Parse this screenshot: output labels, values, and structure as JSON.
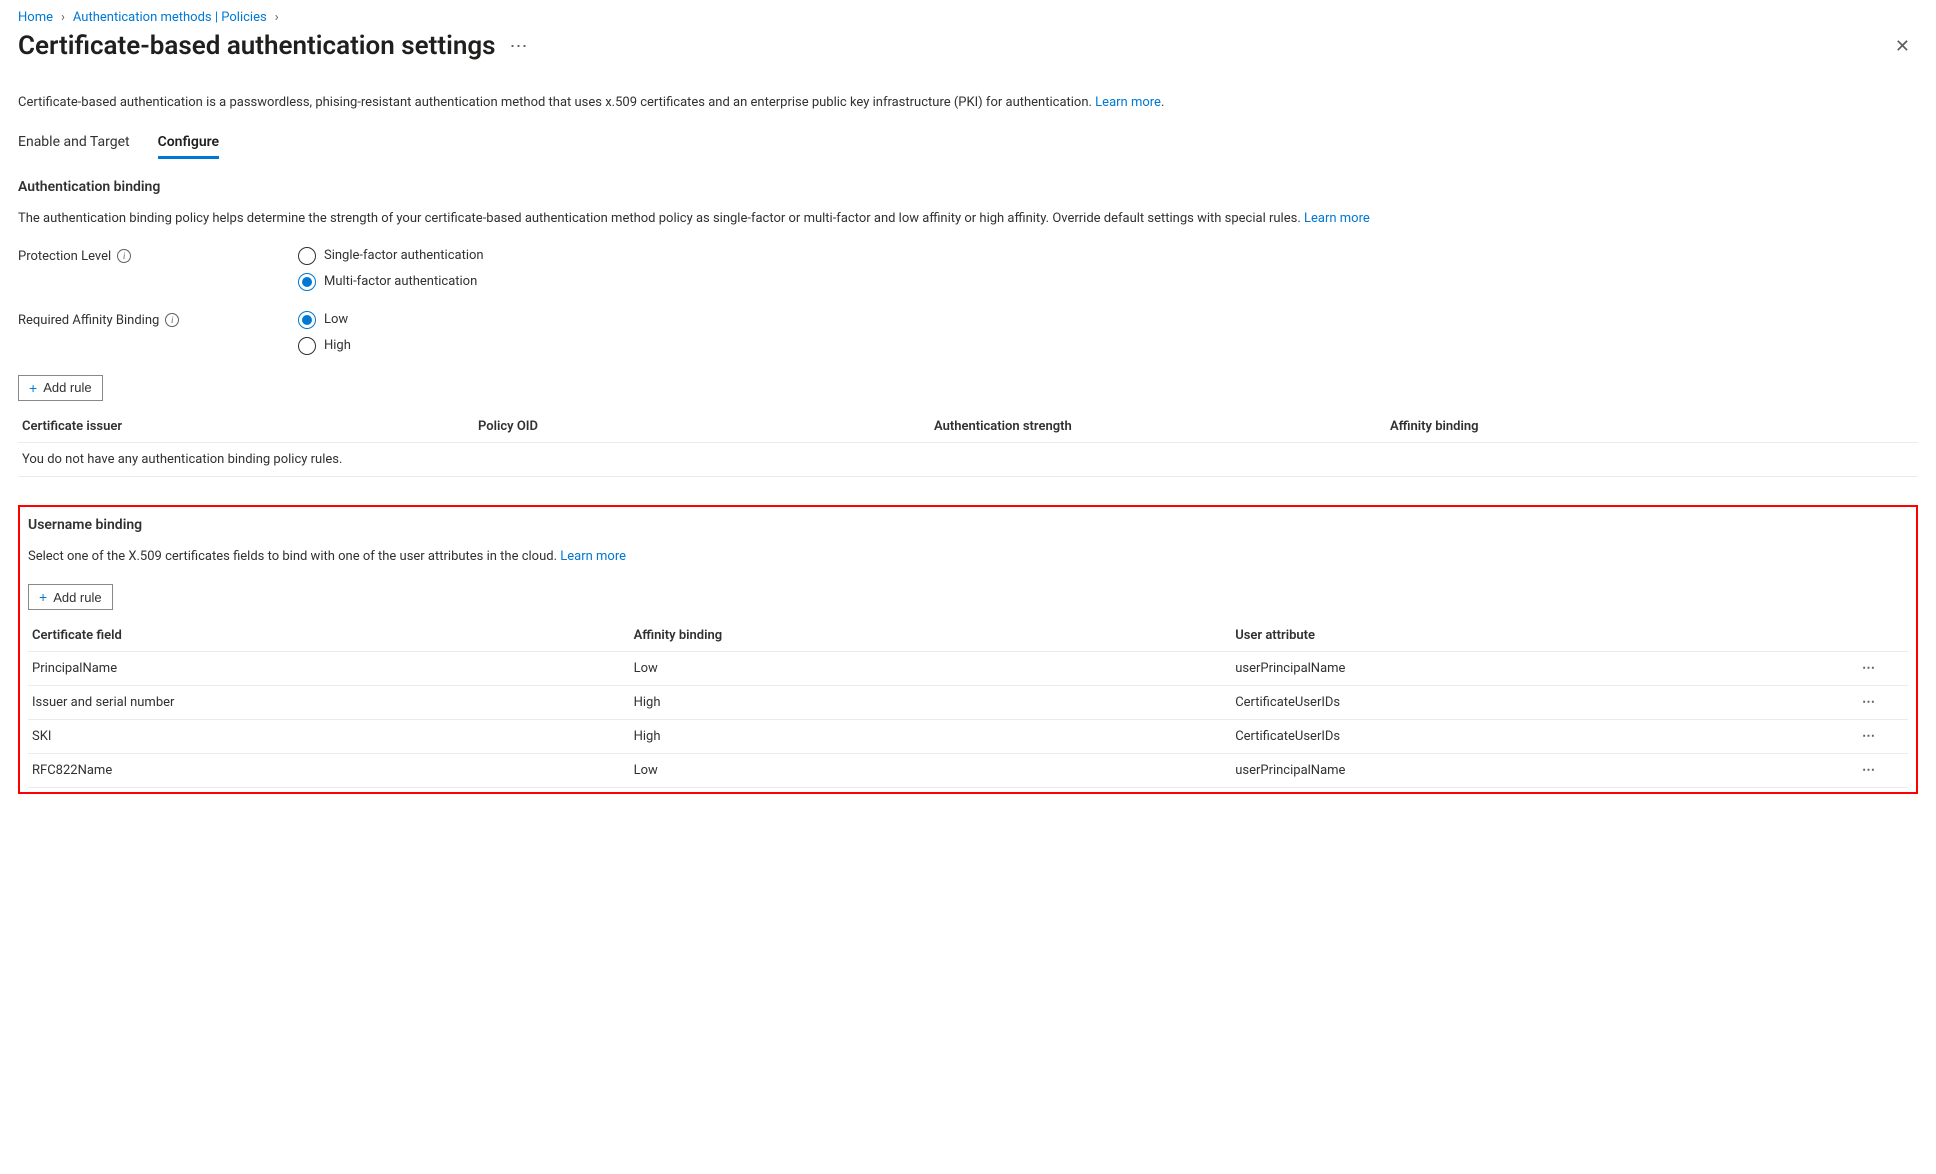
{
  "breadcrumb": {
    "home": "Home",
    "auth": "Authentication methods | Policies"
  },
  "page_title": "Certificate-based authentication settings",
  "description_text": "Certificate-based authentication is a passwordless, phising-resistant authentication method that uses x.509 certificates and an enterprise public key infrastructure (PKI) for authentication. ",
  "learn_more": "Learn more",
  "tabs": {
    "enable": "Enable and Target",
    "configure": "Configure"
  },
  "auth_binding": {
    "title": "Authentication binding",
    "desc": "The authentication binding policy helps determine the strength of your certificate-based authentication method policy as single-factor or multi-factor and low affinity or high affinity. Override default settings with special rules.  ",
    "protection_label": "Protection Level",
    "protection_options": {
      "single": "Single-factor authentication",
      "multi": "Multi-factor authentication"
    },
    "affinity_label": "Required Affinity Binding",
    "affinity_options": {
      "low": "Low",
      "high": "High"
    },
    "add_rule": "Add rule",
    "columns": {
      "issuer": "Certificate issuer",
      "policy": "Policy OID",
      "auth": "Authentication strength",
      "affinity": "Affinity binding"
    },
    "empty": "You do not have any authentication binding policy rules."
  },
  "username_binding": {
    "title": "Username binding",
    "desc": "Select one of the X.509 certificates fields to bind with one of the user attributes in the cloud.  ",
    "add_rule": "Add rule",
    "columns": {
      "field": "Certificate field",
      "affinity": "Affinity binding",
      "user": "User attribute"
    },
    "rows": [
      {
        "field": "PrincipalName",
        "affinity": "Low",
        "user": "userPrincipalName"
      },
      {
        "field": "Issuer and serial number",
        "affinity": "High",
        "user": "CertificateUserIDs"
      },
      {
        "field": "SKI",
        "affinity": "High",
        "user": "CertificateUserIDs"
      },
      {
        "field": "RFC822Name",
        "affinity": "Low",
        "user": "userPrincipalName"
      }
    ]
  }
}
